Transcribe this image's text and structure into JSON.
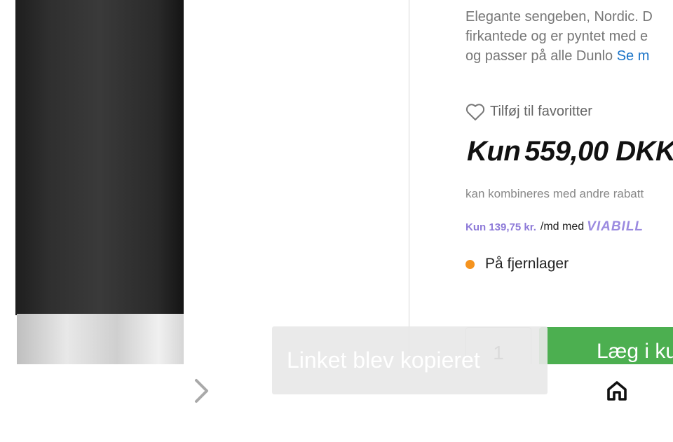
{
  "product": {
    "description_line1": "Elegante sengeben, Nordic. D",
    "description_line2": "firkantede og er pyntet med e",
    "description_line3": "og passer på alle Dunlo",
    "see_more": "Se m"
  },
  "favorites": {
    "label": "Tilføj til favoritter"
  },
  "price": {
    "prefix": "Kun",
    "value": "559,00 DKK"
  },
  "combine_note": "kan kombineres med andre rabatt",
  "viabill": {
    "amount": "Kun 139,75 kr.",
    "per_month": "/md med",
    "brand": "VIABILL"
  },
  "stock": {
    "label": "På fjernlager",
    "status_color": "#f5931e"
  },
  "cart": {
    "quantity": "1",
    "button_label": "Læg i ku"
  },
  "toast": {
    "message": "Linket blev kopieret"
  },
  "colors": {
    "accent_green": "#4caf50",
    "link_blue": "#1a73c7",
    "viabill_purple": "#8d7ad8"
  }
}
